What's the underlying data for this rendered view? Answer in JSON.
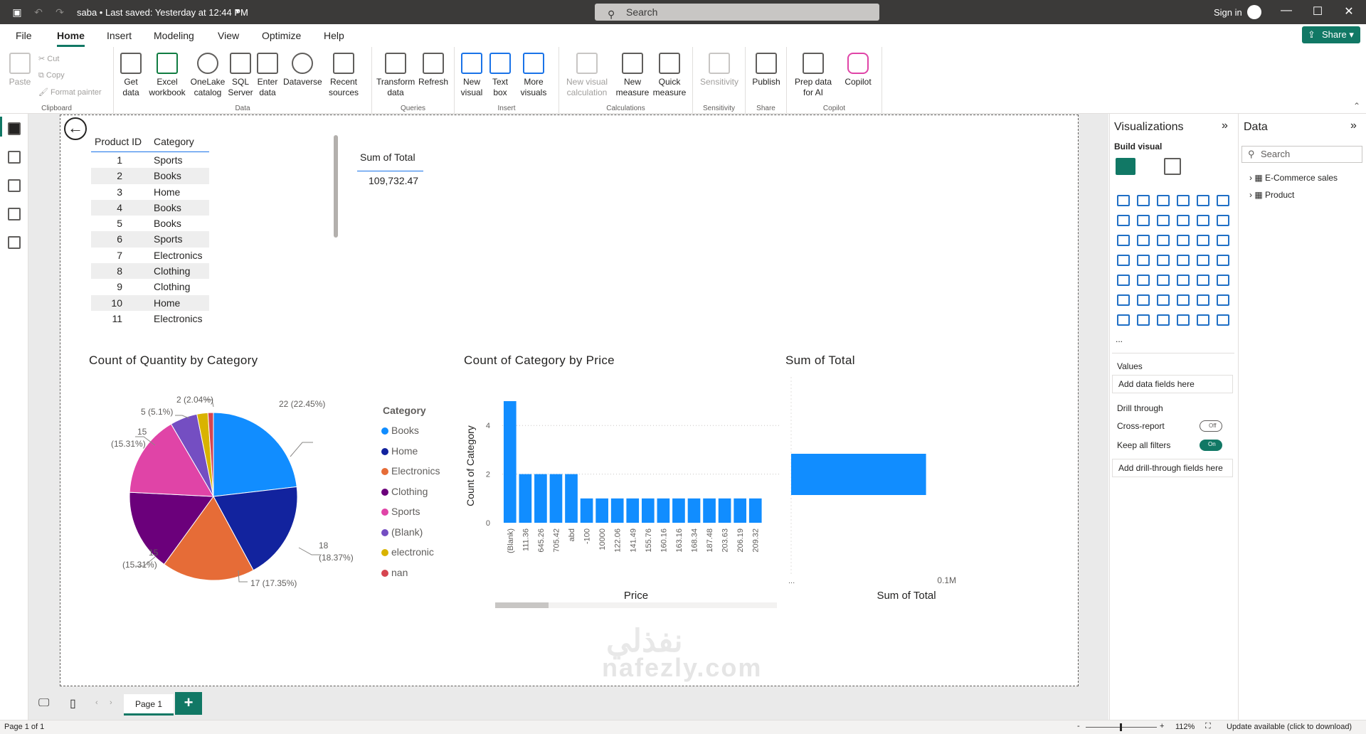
{
  "titlebar": {
    "title": "saba • Last saved: Yesterday at 12:44 PM",
    "search_placeholder": "Search",
    "signin": "Sign in"
  },
  "menu": {
    "items": [
      "File",
      "Home",
      "Insert",
      "Modeling",
      "View",
      "Optimize",
      "Help"
    ],
    "active": "Home",
    "share": "Share"
  },
  "ribbon": {
    "clipboard": {
      "paste": "Paste",
      "cut": "Cut",
      "copy": "Copy",
      "format_painter": "Format painter",
      "label": "Clipboard"
    },
    "data": {
      "get_data": "Get data",
      "excel": "Excel workbook",
      "onelake": "OneLake catalog",
      "sql": "SQL Server",
      "enter": "Enter data",
      "dataverse": "Dataverse",
      "recent": "Recent sources",
      "label": "Data"
    },
    "queries": {
      "transform": "Transform data",
      "refresh": "Refresh",
      "label": "Queries"
    },
    "insert": {
      "new_visual": "New visual",
      "text_box": "Text box",
      "more_visuals": "More visuals",
      "label": "Insert"
    },
    "calculations": {
      "new_visual_calc": "New visual calculation",
      "new_measure": "New measure",
      "quick_measure": "Quick measure",
      "label": "Calculations"
    },
    "sensitivity": {
      "btn": "Sensitivity",
      "label": "Sensitivity"
    },
    "share": {
      "publish": "Publish",
      "label": "Share"
    },
    "copilot": {
      "prep": "Prep data for AI",
      "copilot": "Copilot",
      "label": "Copilot"
    }
  },
  "table": {
    "headers": [
      "Product ID",
      "Category"
    ],
    "rows": [
      [
        "1",
        "Sports"
      ],
      [
        "2",
        "Books"
      ],
      [
        "3",
        "Home"
      ],
      [
        "4",
        "Books"
      ],
      [
        "5",
        "Books"
      ],
      [
        "6",
        "Sports"
      ],
      [
        "7",
        "Electronics"
      ],
      [
        "8",
        "Clothing"
      ],
      [
        "9",
        "Clothing"
      ],
      [
        "10",
        "Home"
      ],
      [
        "11",
        "Electronics"
      ]
    ]
  },
  "card": {
    "title": "Sum of Total",
    "value": "109,732.47"
  },
  "pie_chart": {
    "title": "Count of Quantity by Category",
    "legend_title": "Category",
    "labels": {
      "a": "22 (22.45%)",
      "b1": "18",
      "b2": "(18.37%)",
      "c": "17 (17.35%)",
      "d1": "15",
      "d2": "(15.31%)",
      "e1": "15",
      "e2": "(15.31%)",
      "f": "5 (5.1%)",
      "g": "2 (2.04%)"
    }
  },
  "bar_chart": {
    "title": "Count of Category by Price",
    "xlabel": "Price",
    "ylabel": "Count of Category"
  },
  "hbar_chart": {
    "title": "Sum of Total",
    "xlabel": "Sum of Total",
    "tick_start": "...",
    "tick_end": "0.1M"
  },
  "chart_data": [
    {
      "type": "pie",
      "title": "Count of Quantity by Category",
      "legend_title": "Category",
      "legend_placement": "right",
      "slices": [
        {
          "name": "Books",
          "value": 22,
          "pct": "22.45%",
          "color": "#118dff"
        },
        {
          "name": "Home",
          "value": 18,
          "pct": "18.37%",
          "color": "#12239e"
        },
        {
          "name": "Electronics",
          "value": 17,
          "pct": "17.35%",
          "color": "#e66c37"
        },
        {
          "name": "Clothing",
          "value": 15,
          "pct": "15.31%",
          "color": "#6b007b"
        },
        {
          "name": "Sports",
          "value": 15,
          "pct": "15.31%",
          "color": "#e044a7"
        },
        {
          "name": "(Blank)",
          "value": 5,
          "pct": "5.1%",
          "color": "#744ec2"
        },
        {
          "name": "electronic",
          "value": 2,
          "pct": "2.04%",
          "color": "#d9b300"
        },
        {
          "name": "nan",
          "value": 1,
          "pct": "",
          "color": "#d64550"
        }
      ]
    },
    {
      "type": "bar",
      "title": "Count of Category by Price",
      "xlabel": "Price",
      "ylabel": "Count of Category",
      "categories": [
        "(Blank)",
        "111.36",
        "645.26",
        "705.42",
        "abd",
        "-100",
        "10000",
        "122.06",
        "141.49",
        "155.76",
        "160.16",
        "163.16",
        "168.34",
        "187.48",
        "203.63",
        "206.19",
        "209.32"
      ],
      "values": [
        5,
        2,
        2,
        2,
        2,
        1,
        1,
        1,
        1,
        1,
        1,
        1,
        1,
        1,
        1,
        1,
        1
      ],
      "ylim": [
        0,
        5
      ],
      "yticks": [
        0,
        2,
        4
      ],
      "grid": true,
      "color": "#118dff"
    },
    {
      "type": "bar",
      "orientation": "horizontal",
      "title": "Sum of Total",
      "xlabel": "Sum of Total",
      "values": [
        109732.47
      ],
      "xlim": [
        0,
        100000
      ],
      "color": "#118dff"
    }
  ],
  "visualizations": {
    "title": "Visualizations",
    "build": "Build visual",
    "values": "Values",
    "add_fields": "Add data fields here",
    "drill": "Drill through",
    "cross": "Cross-report",
    "cross_state": "Off",
    "keep": "Keep all filters",
    "keep_state": "On",
    "add_drill": "Add drill-through fields here",
    "more": "..."
  },
  "data_pane": {
    "title": "Data",
    "search": "Search",
    "tables": [
      "E-Commerce sales",
      "Product"
    ]
  },
  "pages": {
    "current": "Page 1"
  },
  "status": {
    "page": "Page 1 of 1",
    "zoom": "112%",
    "update": "Update available (click to download)"
  },
  "watermark": {
    "arabic": "نفذلي",
    "latin": "nafezly.com"
  }
}
